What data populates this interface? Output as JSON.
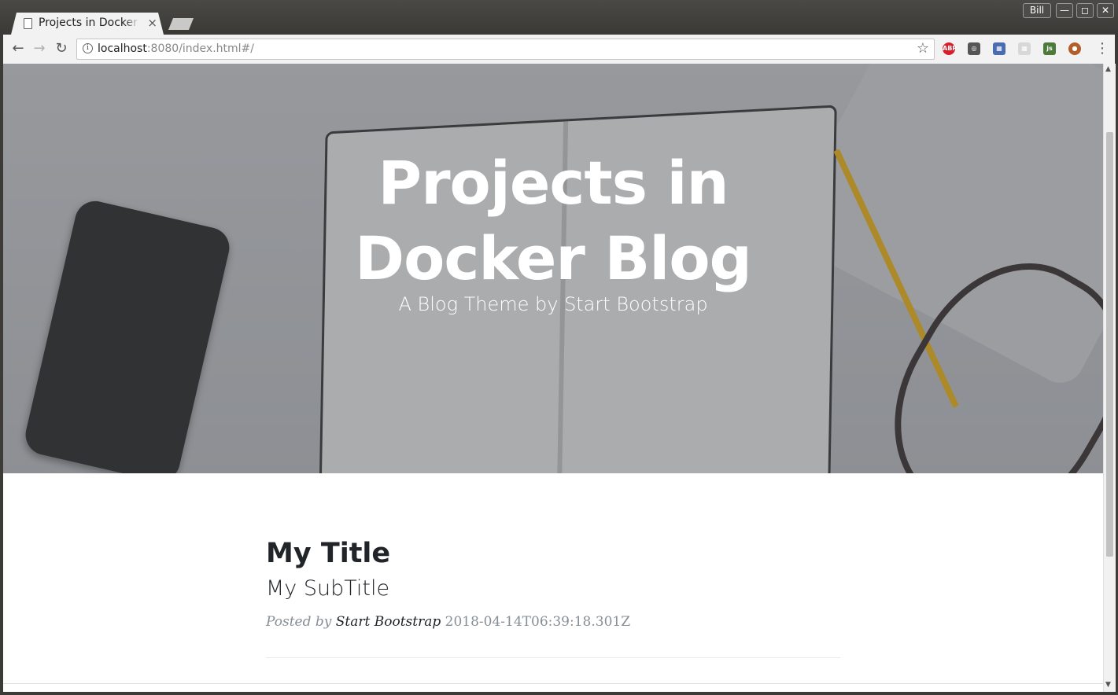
{
  "window": {
    "user": "Bill",
    "minimize": "—",
    "maximize": "◻",
    "close": "✕"
  },
  "tab": {
    "title": "Projects in Docker Blog",
    "close": "×"
  },
  "toolbar": {
    "back": "←",
    "forward": "→",
    "reload": "↻",
    "url_host": "localhost",
    "url_rest": ":8080/index.html#/",
    "star": "☆",
    "menu": "⋮",
    "extensions": [
      {
        "name": "adblock-plus-icon",
        "label": "ABP",
        "color": "#d5202c"
      },
      {
        "name": "pocket-icon",
        "label": "◎",
        "color": "#555555"
      },
      {
        "name": "colorzilla-icon",
        "label": "▦",
        "color": "#4a6cb0"
      },
      {
        "name": "extension-grid-icon",
        "label": "▦",
        "color": "#d8d8d8"
      },
      {
        "name": "js-toggle-icon",
        "label": "js",
        "color": "#4b7a3b"
      },
      {
        "name": "tampermonkey-icon",
        "label": "●",
        "color": "#b35d2a"
      }
    ]
  },
  "hero": {
    "title_line1": "Projects in",
    "title_line2": "Docker Blog",
    "subtitle": "A Blog Theme by Start Bootstrap"
  },
  "post": {
    "title": "My Title",
    "subtitle": "My SubTitle",
    "posted_by": "Posted by",
    "author": "Start Bootstrap",
    "date": "2018-04-14T06:39:18.301Z"
  },
  "scrollbar": {
    "up": "▲",
    "down": "▼"
  }
}
